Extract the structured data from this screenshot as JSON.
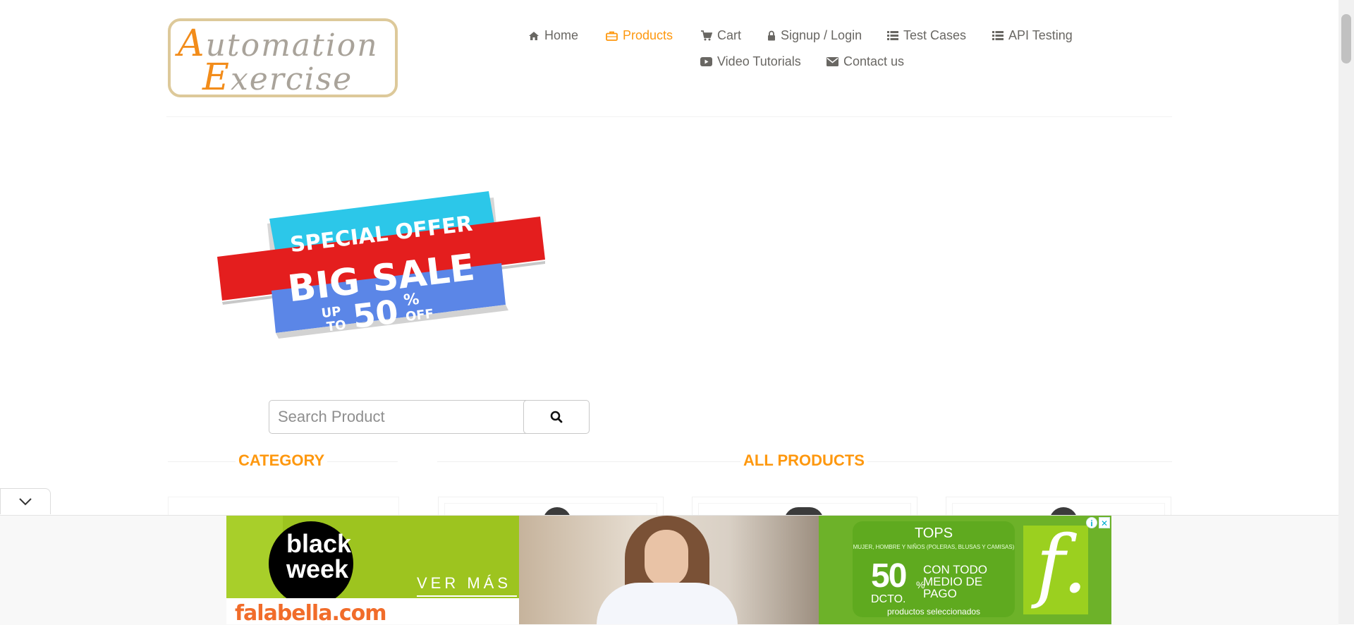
{
  "logo": {
    "line1_first": "A",
    "line1_rest": "utomation",
    "line2_first": "E",
    "line2_rest": "xercise"
  },
  "nav": {
    "items": [
      {
        "label": "Home",
        "icon": "home-icon",
        "active": false
      },
      {
        "label": "Products",
        "icon": "briefcase-icon",
        "active": true
      },
      {
        "label": "Cart",
        "icon": "cart-icon",
        "active": false
      },
      {
        "label": "Signup / Login",
        "icon": "lock-icon",
        "active": false
      },
      {
        "label": "Test Cases",
        "icon": "list-icon",
        "active": false
      },
      {
        "label": "API Testing",
        "icon": "list-icon",
        "active": false
      },
      {
        "label": "Video Tutorials",
        "icon": "youtube-icon",
        "active": false
      },
      {
        "label": "Contact us",
        "icon": "envelope-icon",
        "active": false
      }
    ]
  },
  "sale_banner": {
    "line1": "SPECIAL OFFER",
    "line2": "BIG SALE",
    "up": "UP",
    "to": "TO",
    "percent": "50",
    "percent_sign": "%",
    "off": "OFF"
  },
  "search": {
    "placeholder": "Search Product",
    "value": ""
  },
  "sections": {
    "category": "CATEGORY",
    "all_products": "ALL PRODUCTS"
  },
  "ad": {
    "black": "black",
    "week": "week",
    "ver_mas": "VER MÁS",
    "brand": "falabella.com",
    "tops": "TOPS",
    "tops_sub": "MUJER, HOMBRE Y NIÑOS (POLERAS, BLUSAS Y CAMISAS)",
    "percent": "50",
    "percent_sign": "%",
    "dcto": "DCTO.",
    "medio": "CON TODO MEDIO DE PAGO",
    "productos": "productos seleccionados",
    "f_logo": "f.",
    "info": "i",
    "close": "✕"
  },
  "colors": {
    "accent": "#fe980f",
    "text": "#696763",
    "ad_green": "#9dc41f",
    "ad_brand": "#f16c2a"
  }
}
